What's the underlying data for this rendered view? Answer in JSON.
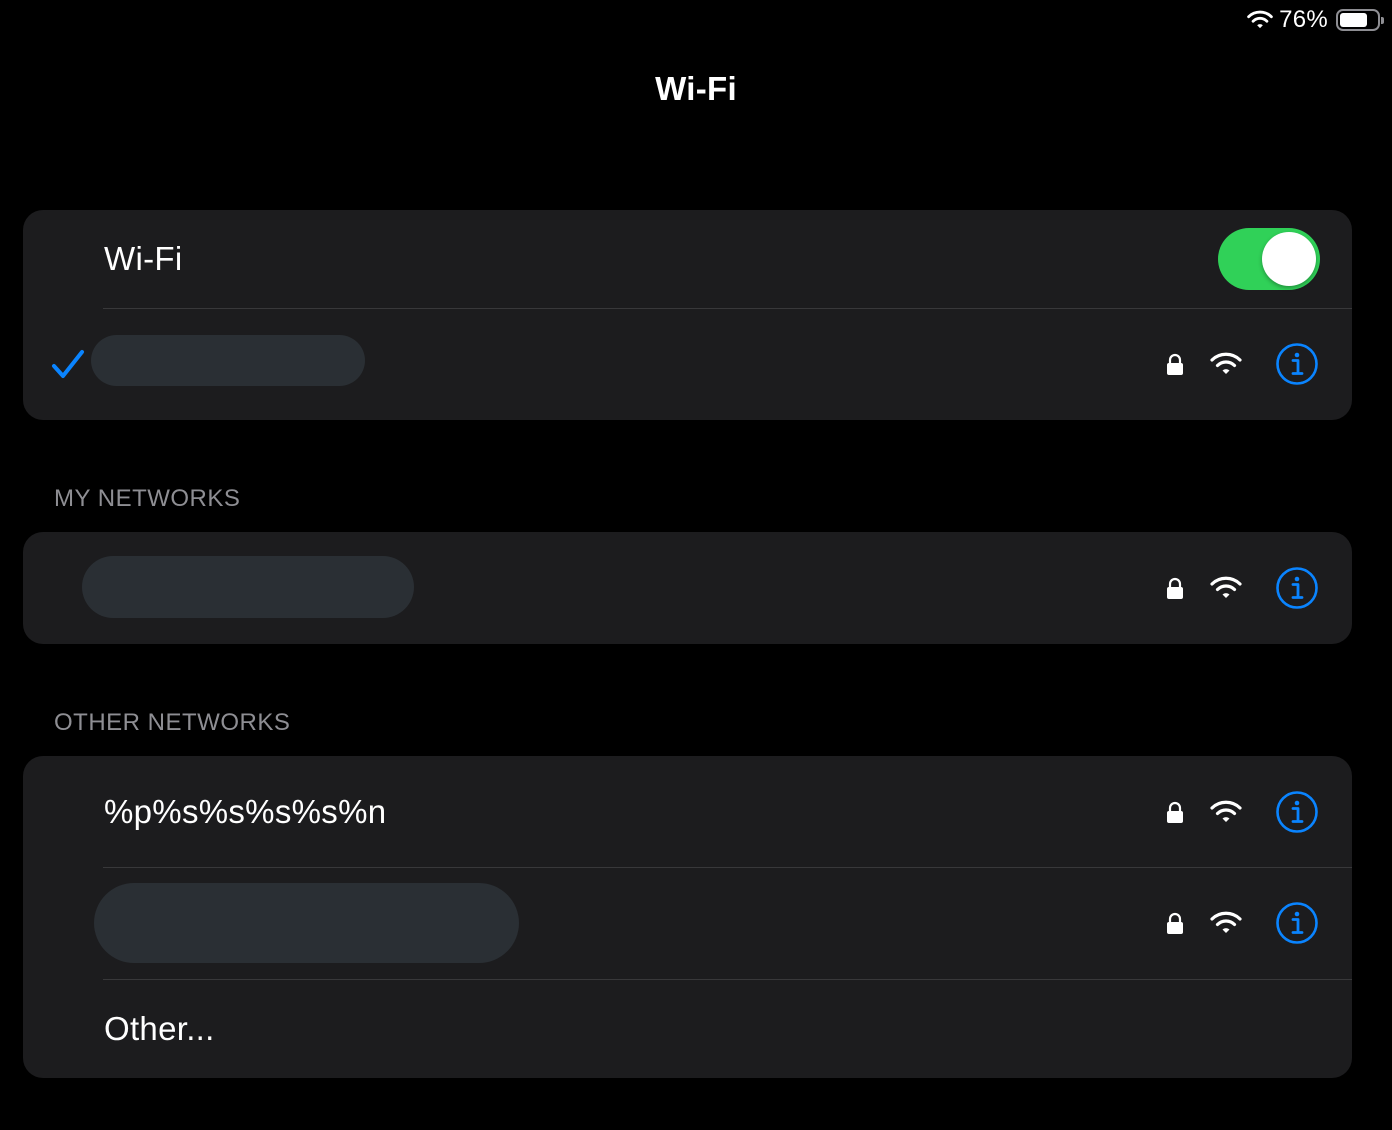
{
  "status_bar": {
    "battery_percent": "76%",
    "battery_level": 0.76,
    "wifi_icon": "wifi-signal-icon",
    "battery_icon": "battery-icon"
  },
  "nav": {
    "title": "Wi-Fi"
  },
  "wifi_toggle_group": {
    "toggle_label": "Wi-Fi",
    "toggle_on": true,
    "toggle_color": "#30d158",
    "connected_network": {
      "name_redacted": true,
      "secured": true,
      "selected_icon": "checkmark-icon"
    }
  },
  "my_networks": {
    "header": "MY NETWORKS",
    "items": [
      {
        "name_redacted": true,
        "secured": true
      }
    ]
  },
  "other_networks": {
    "header": "OTHER NETWORKS",
    "items": [
      {
        "name": "%p%s%s%s%s%n",
        "secured": true
      },
      {
        "name_redacted": true,
        "secured": true
      }
    ],
    "other_label": "Other..."
  },
  "colors": {
    "background": "#000000",
    "group_background": "#1c1c1e",
    "separator": "#38383a",
    "accent_blue": "#0a84ff",
    "secondary_text": "#8e8e93",
    "redaction": "#2a2f34"
  },
  "icons": {
    "lock": "lock-icon",
    "wifi": "wifi-signal-icon",
    "info": "info-circle-icon"
  }
}
